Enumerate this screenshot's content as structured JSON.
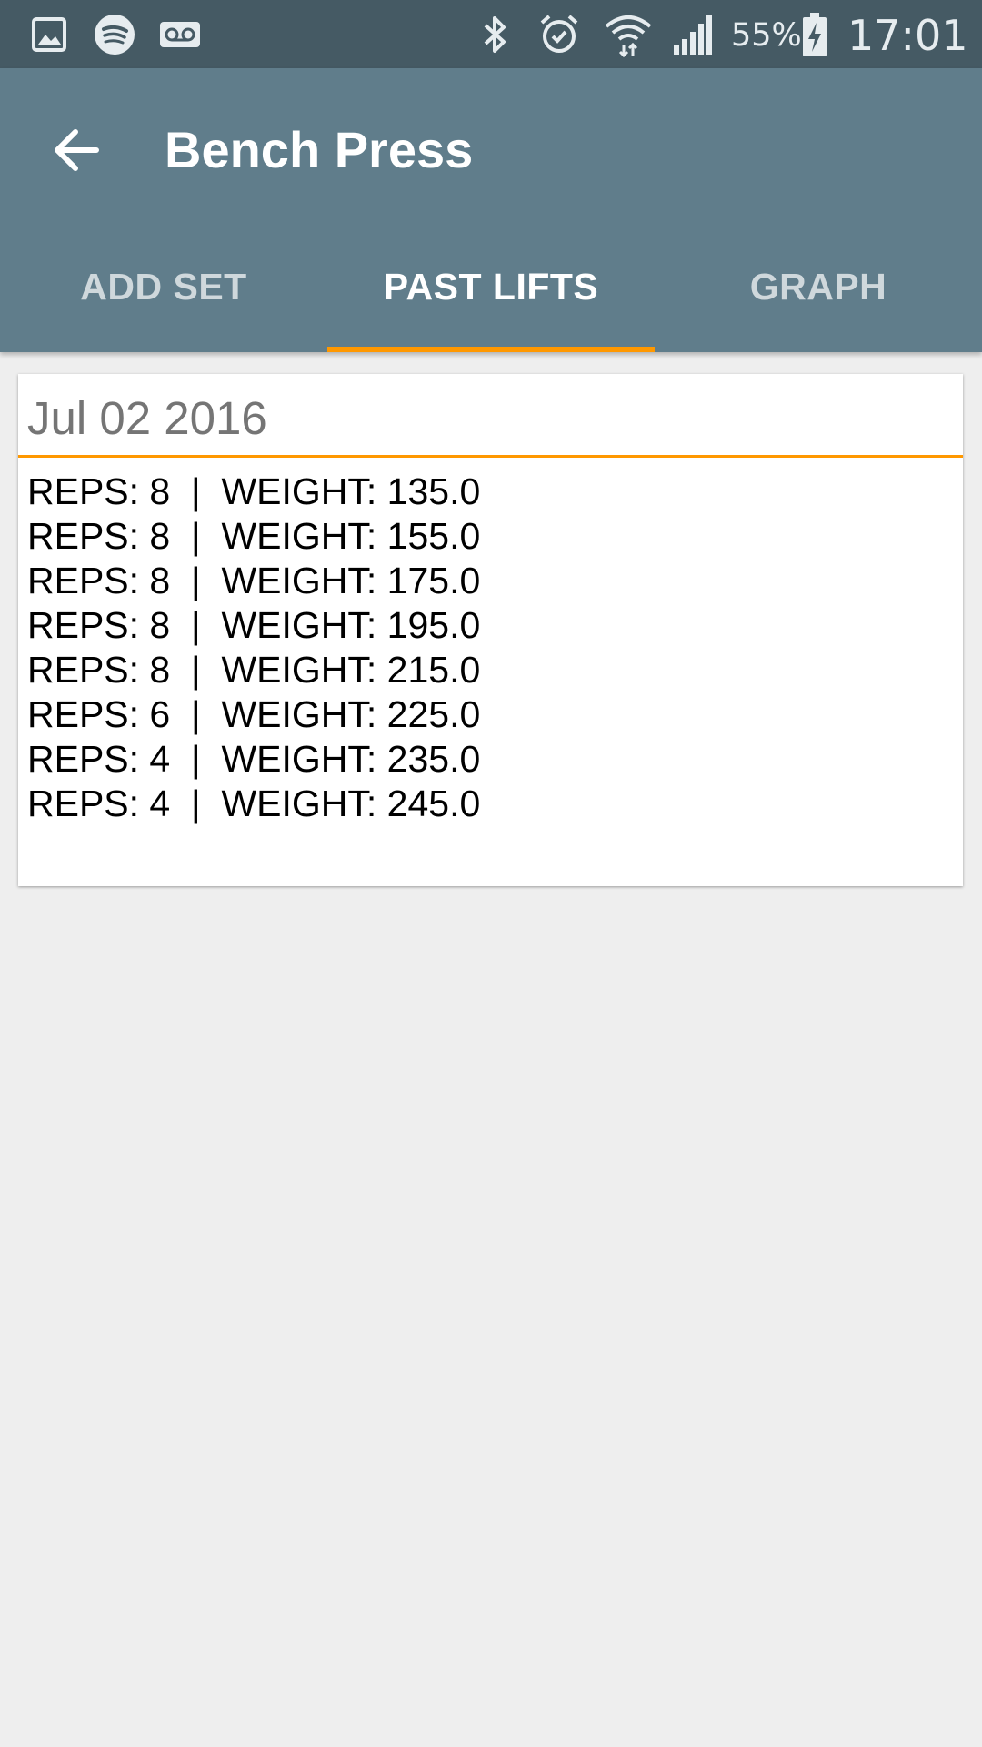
{
  "status_bar": {
    "notification_icons": [
      "gallery-icon",
      "spotify-icon",
      "voicemail-icon"
    ],
    "system_icons": [
      "bluetooth-icon",
      "alarm-icon",
      "wifi-icon",
      "signal-icon",
      "battery-charging-icon"
    ],
    "battery": "55%",
    "time": "17:01"
  },
  "app_bar": {
    "back_icon": "arrow-back-icon",
    "title": "Bench Press",
    "color": "#607d8b"
  },
  "tabs": [
    {
      "label": "ADD SET",
      "active": false
    },
    {
      "label": "PAST LIFTS",
      "active": true
    },
    {
      "label": "GRAPH",
      "active": false
    }
  ],
  "accent_color": "#ff9800",
  "workouts": [
    {
      "date": "Jul 02 2016",
      "sets": [
        "REPS: 8  |  WEIGHT: 135.0",
        "REPS: 8  |  WEIGHT: 155.0",
        "REPS: 8  |  WEIGHT: 175.0",
        "REPS: 8  |  WEIGHT: 195.0",
        "REPS: 8  |  WEIGHT: 215.0",
        "REPS: 6  |  WEIGHT: 225.0",
        "REPS: 4  |  WEIGHT: 235.0",
        "REPS: 4  |  WEIGHT: 245.0"
      ]
    }
  ]
}
